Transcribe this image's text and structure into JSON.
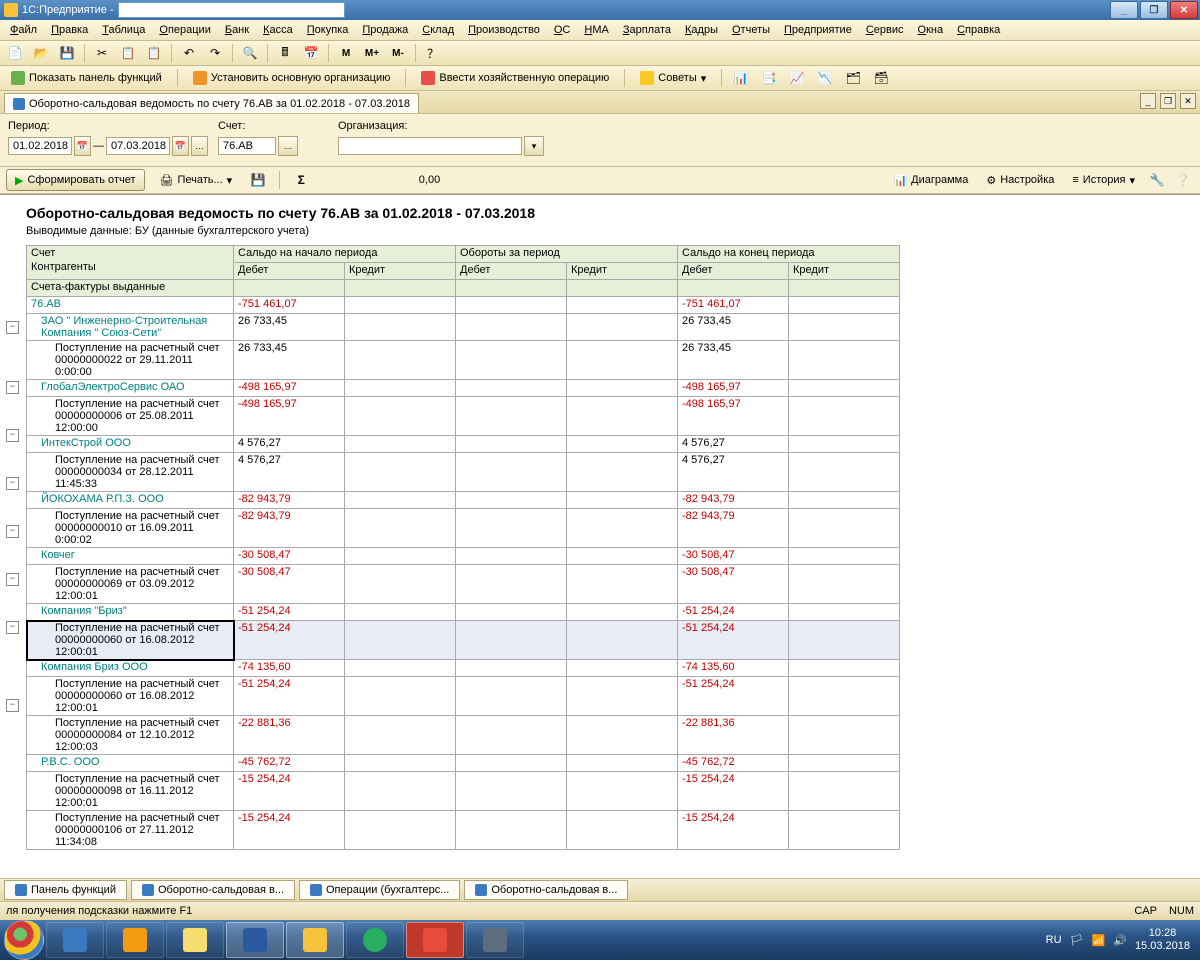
{
  "title": "1С:Предприятие -",
  "menu": [
    "Файл",
    "Правка",
    "Таблица",
    "Операции",
    "Банк",
    "Касса",
    "Покупка",
    "Продажа",
    "Склад",
    "Производство",
    "ОС",
    "НМА",
    "Зарплата",
    "Кадры",
    "Отчеты",
    "Предприятие",
    "Сервис",
    "Окна",
    "Справка"
  ],
  "t2": {
    "panel": "Показать панель функций",
    "org": "Установить основную организацию",
    "oper": "Ввести хозяйственную операцию",
    "adv": "Советы"
  },
  "tabTitle": "Оборотно-сальдовая ведомость по счету 76.АВ за 01.02.2018 - 07.03.2018",
  "labels": {
    "period": "Период:",
    "account": "Счет:",
    "org": "Организация:"
  },
  "period_from": "01.02.2018",
  "period_to": "07.03.2018",
  "account": "76.АВ",
  "act": {
    "form": "Сформировать отчет",
    "print": "Печать...",
    "sum": "0,00",
    "diag": "Диаграмма",
    "set": "Настройка",
    "hist": "История"
  },
  "rep": {
    "title": "Оборотно-сальдовая ведомость по счету 76.АВ за 01.02.2018 - 07.03.2018",
    "sub": "Выводимые данные:  БУ (данные бухгалтерского учета)",
    "h": {
      "acct": "Счет",
      "start": "Сальдо на начало периода",
      "turn": "Обороты за период",
      "end": "Сальдо на конец периода",
      "contr": "Контрагенты",
      "d": "Дебет",
      "c": "Кредит",
      "inv": "Счета-фактуры выданные"
    },
    "rows": [
      {
        "lvl": 0,
        "t": "76.АВ",
        "sd": "-751 461,07",
        "ed": "-751 461,07",
        "neg": true,
        "teal": true
      },
      {
        "lvl": 1,
        "t": "ЗАО \" Инженерно-Строительная Компания \" Союз-Сети\"",
        "sd": "26 733,45",
        "ed": "26 733,45",
        "teal": true
      },
      {
        "lvl": 2,
        "t": "Поступление на расчетный счет 00000000022 от 29.11.2011 0:00:00",
        "sd": "26 733,45",
        "ed": "26 733,45"
      },
      {
        "lvl": 1,
        "t": "ГлобалЭлектроСервис ОАО",
        "sd": "-498 165,97",
        "ed": "-498 165,97",
        "neg": true,
        "teal": true
      },
      {
        "lvl": 2,
        "t": "Поступление на расчетный счет 00000000006 от 25.08.2011 12:00:00",
        "sd": "-498 165,97",
        "ed": "-498 165,97",
        "neg": true
      },
      {
        "lvl": 1,
        "t": "ИнтекСтрой ООО",
        "sd": "4 576,27",
        "ed": "4 576,27",
        "teal": true
      },
      {
        "lvl": 2,
        "t": "Поступление на расчетный счет 00000000034 от 28.12.2011 11:45:33",
        "sd": "4 576,27",
        "ed": "4 576,27"
      },
      {
        "lvl": 1,
        "t": "ЙОКОХАМА Р.П.З. ООО",
        "sd": "-82 943,79",
        "ed": "-82 943,79",
        "neg": true,
        "teal": true
      },
      {
        "lvl": 2,
        "t": "Поступление на расчетный счет 00000000010 от 16.09.2011 0:00:02",
        "sd": "-82 943,79",
        "ed": "-82 943,79",
        "neg": true
      },
      {
        "lvl": 1,
        "t": "Ковчег",
        "sd": "-30 508,47",
        "ed": "-30 508,47",
        "neg": true,
        "teal": true
      },
      {
        "lvl": 2,
        "t": "Поступление на расчетный счет 00000000069 от 03.09.2012 12:00:01",
        "sd": "-30 508,47",
        "ed": "-30 508,47",
        "neg": true
      },
      {
        "lvl": 1,
        "t": "Компания \"Бриз\"",
        "sd": "-51 254,24",
        "ed": "-51 254,24",
        "neg": true,
        "teal": true
      },
      {
        "lvl": 2,
        "t": "Поступление на расчетный счет 00000000060 от 16.08.2012 12:00:01",
        "sd": "-51 254,24",
        "ed": "-51 254,24",
        "neg": true,
        "sel": true
      },
      {
        "lvl": 1,
        "t": "Компания Бриз ООО",
        "sd": "-74 135,60",
        "ed": "-74 135,60",
        "neg": true,
        "teal": true
      },
      {
        "lvl": 2,
        "t": "Поступление на расчетный счет 00000000060 от 16.08.2012 12:00:01",
        "sd": "-51 254,24",
        "ed": "-51 254,24",
        "neg": true
      },
      {
        "lvl": 2,
        "t": "Поступление на расчетный счет 00000000084 от 12.10.2012 12:00:03",
        "sd": "-22 881,36",
        "ed": "-22 881,36",
        "neg": true
      },
      {
        "lvl": 1,
        "t": "Р.В.С. ООО",
        "sd": "-45 762,72",
        "ed": "-45 762,72",
        "neg": true,
        "teal": true
      },
      {
        "lvl": 2,
        "t": "Поступление на расчетный счет 00000000098 от 16.11.2012 12:00:01",
        "sd": "-15 254,24",
        "ed": "-15 254,24",
        "neg": true
      },
      {
        "lvl": 2,
        "t": "Поступление на расчетный счет 00000000106 от 27.11.2012 11:34:08",
        "sd": "-15 254,24",
        "ed": "-15 254,24",
        "neg": true
      }
    ]
  },
  "bottabs": [
    "Панель функций",
    "Оборотно-сальдовая в...",
    "Операции (бухгалтерс...",
    "Оборотно-сальдовая в..."
  ],
  "status": {
    "hint": "ля получения подсказки нажмите F1",
    "cap": "CAP",
    "num": "NUM"
  },
  "tray": {
    "lang": "RU",
    "time": "10:28",
    "date": "15.03.2018"
  }
}
